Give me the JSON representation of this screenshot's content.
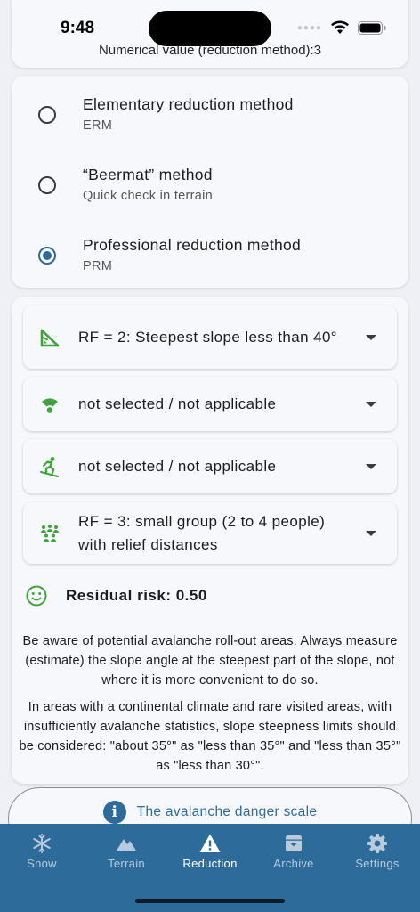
{
  "status_bar": {
    "time": "9:48"
  },
  "risk_scale_colors": [
    "#3fa33c",
    "#f8e535",
    "#f79a1d",
    "#e8393a"
  ],
  "header": {
    "numerical_value": "Numerical value (reduction method):3"
  },
  "methods": [
    {
      "title": "Elementary reduction method",
      "subtitle": "ERM",
      "selected": false
    },
    {
      "title": "“Beermat” method",
      "subtitle": "Quick check in terrain",
      "selected": false
    },
    {
      "title": "Professional reduction method",
      "subtitle": "PRM",
      "selected": true
    }
  ],
  "factors": [
    {
      "icon": "slope-angle-icon",
      "value": "RF = 2: Steepest slope less than 40°"
    },
    {
      "icon": "exposition-icon",
      "value": "not selected / not applicable"
    },
    {
      "icon": "skier-icon",
      "value": "not selected / not applicable"
    },
    {
      "icon": "group-icon",
      "value": "RF = 3: small group (2 to 4 people) with relief distances"
    }
  ],
  "residual": {
    "icon": "smiley-icon",
    "label": "Residual risk: 0.50"
  },
  "notes": [
    "Be aware of potential avalanche roll-out areas. Always measure (estimate) the slope angle at the steepest part of the slope, not where it is more convenient to do so.",
    "In areas with a continental climate and rare visited areas, with insufficiently avalanche statistics, slope steepness limits should be considered: \"about 35°\" as \"less than 35°\" and \"less than 35°\" as \"less than 30°\"."
  ],
  "danger_scale_button": {
    "icon": "info-icon",
    "label": "The avalanche danger scale"
  },
  "tabs": [
    {
      "label": "Snow",
      "icon": "snowflake-icon",
      "active": false
    },
    {
      "label": "Terrain",
      "icon": "mountain-icon",
      "active": false
    },
    {
      "label": "Reduction",
      "icon": "warning-icon",
      "active": true
    },
    {
      "label": "Archive",
      "icon": "archive-icon",
      "active": false
    },
    {
      "label": "Settings",
      "icon": "gear-icon",
      "active": false
    }
  ],
  "colors": {
    "accent": "#2d6b9b",
    "green_icon": "#3fa33c",
    "tab_bar": "#2d6b9b"
  }
}
